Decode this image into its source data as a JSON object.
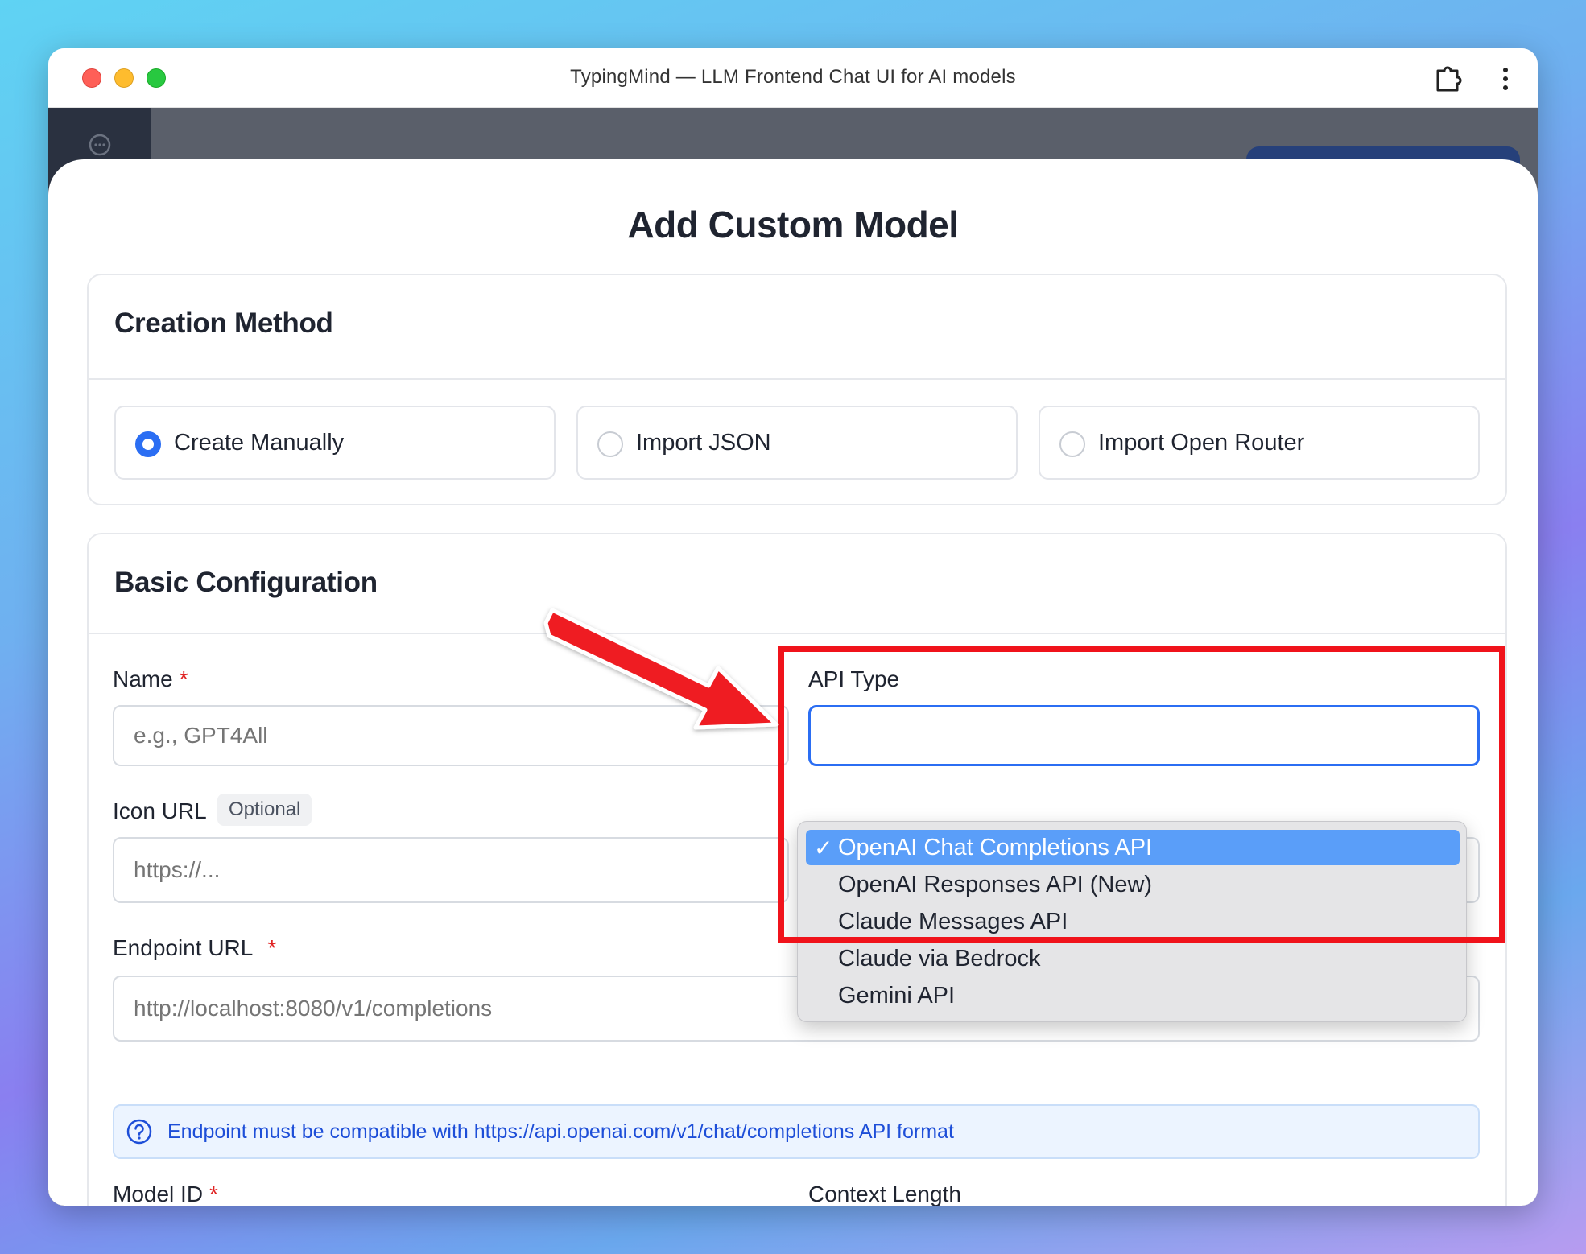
{
  "window": {
    "title": "TypingMind — LLM Frontend Chat UI for AI models"
  },
  "icons": {
    "extension": "puzzle-piece-icon",
    "menu": "vertical-ellipsis-icon",
    "sidebar_chat": "chat-bubble-icon",
    "info": "question-circle-icon"
  },
  "modal": {
    "title": "Add Custom Model"
  },
  "creation_method": {
    "title": "Creation Method",
    "options": [
      {
        "label": "Create Manually",
        "checked": true
      },
      {
        "label": "Import JSON",
        "checked": false
      },
      {
        "label": "Import Open Router",
        "checked": false
      }
    ]
  },
  "basic_config": {
    "title": "Basic Configuration",
    "name": {
      "label": "Name",
      "required_mark": "*",
      "placeholder": "e.g., GPT4All"
    },
    "icon_url": {
      "label": "Icon URL",
      "badge": "Optional",
      "placeholder": "https://..."
    },
    "api_type": {
      "label": "API Type",
      "selected": "OpenAI Chat Completions API",
      "check_mark": "✓",
      "options": [
        "OpenAI Chat Completions API",
        "OpenAI Responses API (New)",
        "Claude Messages API",
        "Claude via Bedrock",
        "Gemini API"
      ]
    },
    "endpoint_url": {
      "label": "Endpoint URL",
      "required_mark": "*",
      "placeholder": "http://localhost:8080/v1/completions",
      "info": "Endpoint must be compatible with https://api.openai.com/v1/chat/completions API format"
    },
    "model_id": {
      "label": "Model ID",
      "required_mark": "*"
    },
    "context_length": {
      "label": "Context Length"
    }
  },
  "colors": {
    "accent": "#2b6ef3",
    "highlight": "#f0131b",
    "selected_option": "#5a9ef9"
  }
}
